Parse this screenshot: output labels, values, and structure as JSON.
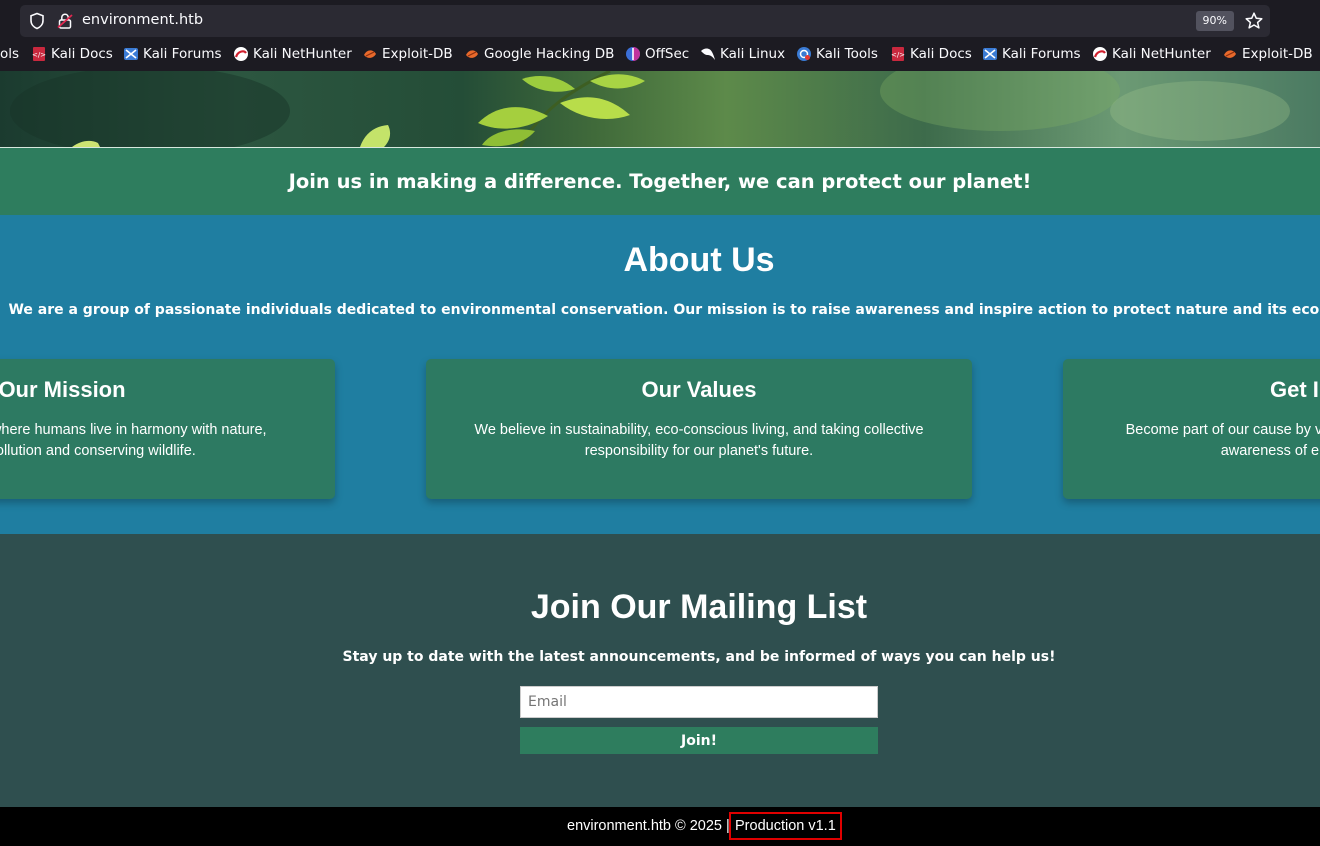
{
  "browser": {
    "url": "environment.htb",
    "zoom": "90%",
    "bookmarks": [
      {
        "label": "ols",
        "icon": "tools-icon"
      },
      {
        "label": "Kali Docs",
        "icon": "kali-docs-icon"
      },
      {
        "label": "Kali Forums",
        "icon": "kali-forums-icon"
      },
      {
        "label": "Kali NetHunter",
        "icon": "kali-nethunter-icon"
      },
      {
        "label": "Exploit-DB",
        "icon": "exploit-db-icon"
      },
      {
        "label": "Google Hacking DB",
        "icon": "google-hacking-db-icon"
      },
      {
        "label": "OffSec",
        "icon": "offsec-icon"
      },
      {
        "label": "Kali Linux",
        "icon": "kali-linux-icon"
      },
      {
        "label": "Kali Tools",
        "icon": "kali-tools-icon"
      },
      {
        "label": "Kali Docs",
        "icon": "kali-docs-icon"
      },
      {
        "label": "Kali Forums",
        "icon": "kali-forums-icon"
      },
      {
        "label": "Kali NetHunter",
        "icon": "kali-nethunter-icon"
      },
      {
        "label": "Exploit-DB",
        "icon": "exploit-db-icon"
      }
    ]
  },
  "banner": {
    "text": "Join us in making a difference. Together, we can protect our planet!"
  },
  "about": {
    "title": "About Us",
    "description": "We are a group of passionate individuals dedicated to environmental conservation. Our mission is to raise awareness and inspire action to protect nature and its ecosystems.",
    "cards": [
      {
        "title": "Our Mission",
        "description": "We envision a world where humans live in harmony with nature, reducing pollution and conserving wildlife."
      },
      {
        "title": "Our Values",
        "description": "We believe in sustainability, eco-conscious living, and taking collective responsibility for our planet's future."
      },
      {
        "title": "Get Involved",
        "description": "Become part of our cause by volunteering, donating, or spreading awareness of environmental issues."
      }
    ]
  },
  "mailing": {
    "title": "Join Our Mailing List",
    "description": "Stay up to date with the latest announcements, and be informed of ways you can help us!",
    "email_placeholder": "Email",
    "button_label": "Join!"
  },
  "footer": {
    "copyright": "environment.htb © 2025 |",
    "version": "Production v1.1"
  },
  "colors": {
    "banner": "#2e7d5e",
    "about": "#1f7ea1",
    "card": "#2d7a62",
    "mailing": "#2f4f4f",
    "footer": "#000000",
    "highlight": "#e00000"
  }
}
